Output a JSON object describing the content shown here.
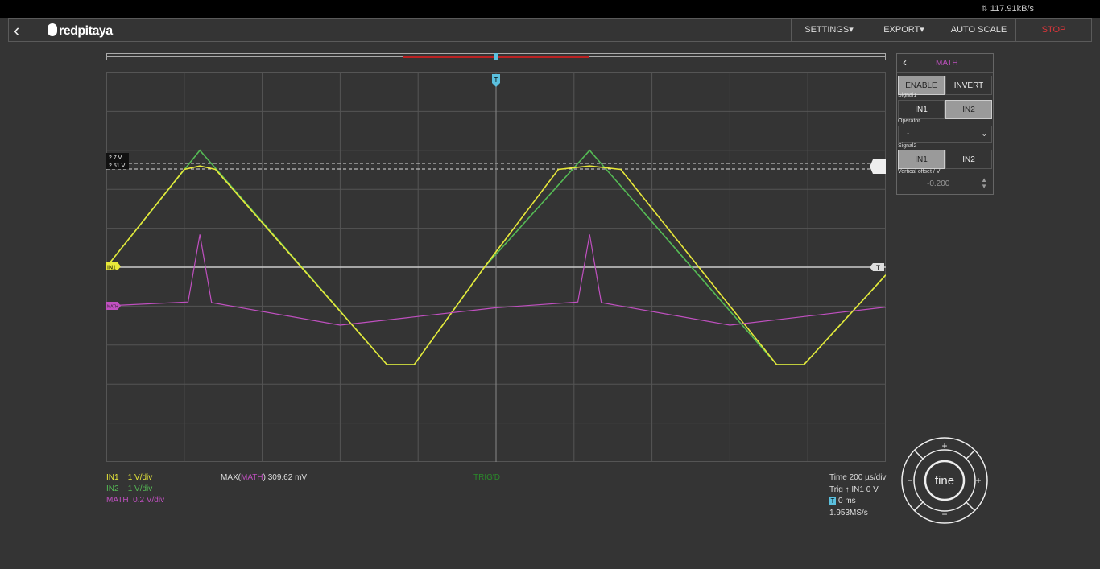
{
  "topbar": {
    "data_rate": "117.91kB/s",
    "rate_icon": "updown-arrows-icon"
  },
  "navbar": {
    "back_icon": "‹",
    "logo_text": "redpitaya",
    "buttons": [
      {
        "label": "SETTINGS▾"
      },
      {
        "label": "EXPORT▾"
      },
      {
        "label": "AUTO SCALE"
      },
      {
        "label": "STOP"
      }
    ]
  },
  "scope": {
    "cursor_labels": [
      "2.7 V",
      "2.51 V"
    ],
    "ch1_marker": "IN1",
    "math_marker": "MATH",
    "trigger_marker": "T",
    "colors": {
      "in1": "#e8e83a",
      "in2": "#55bb55",
      "math": "#c050c0",
      "grid": "#555555",
      "trigger": "#5bc0de"
    }
  },
  "chart_data": {
    "type": "line",
    "series": [
      {
        "name": "IN2",
        "x": [
          0,
          1.2,
          3.6,
          3.95,
          4.85,
          6.2,
          8.6,
          8.95,
          10
        ],
        "y": [
          0,
          3.0,
          -2.5,
          -2.5,
          0,
          3.0,
          -2.5,
          -2.5,
          -0.2
        ]
      },
      {
        "name": "IN1",
        "x": [
          0,
          1.0,
          1.2,
          1.4,
          3.6,
          3.95,
          4.85,
          5.8,
          6.2,
          6.6,
          8.6,
          8.95,
          10
        ],
        "y": [
          0,
          2.51,
          2.6,
          2.51,
          -2.5,
          -2.5,
          0,
          2.51,
          2.6,
          2.51,
          -2.5,
          -2.5,
          -0.2
        ]
      },
      {
        "name": "MATH",
        "x": [
          0,
          1.05,
          1.2,
          1.35,
          3.0,
          5.0,
          6.05,
          6.2,
          6.35,
          8.0,
          10
        ],
        "y": [
          -0.8,
          -0.74,
          0.31,
          -0.75,
          -1.1,
          -0.83,
          -0.74,
          0.31,
          -0.75,
          -1.1,
          -0.82
        ]
      }
    ],
    "divisions": {
      "x": 10,
      "y": 10
    }
  },
  "legend": {
    "in1": {
      "name": "IN1",
      "scale": "1 V/div"
    },
    "in2": {
      "name": "IN2",
      "scale": "1 V/div"
    },
    "math": {
      "name": "MATH",
      "scale": "0.2 V/div"
    },
    "measure_prefix": "MAX(",
    "measure_name": "MATH",
    "measure_suffix": ") 309.62 mV",
    "trig_status": "TRIG'D"
  },
  "info": {
    "time": "Time 200 µs/div",
    "trig": "Trig ↑ IN1 0 V",
    "delay": "0 ms",
    "sample_rate": "1.953MS/s"
  },
  "math_panel": {
    "title": "MATH",
    "enable": "ENABLE",
    "invert": "INVERT",
    "signal1_label": "Signal1",
    "signal1_opts": [
      "IN1",
      "IN2"
    ],
    "operator_label": "Operator",
    "operator_value": "-",
    "signal2_label": "Signal2",
    "signal2_opts": [
      "IN1",
      "IN2"
    ],
    "offset_label": "Vertical offset / V",
    "offset_value": "-0.200"
  },
  "wheel": {
    "center": "fine",
    "plus": "+",
    "minus": "−"
  }
}
